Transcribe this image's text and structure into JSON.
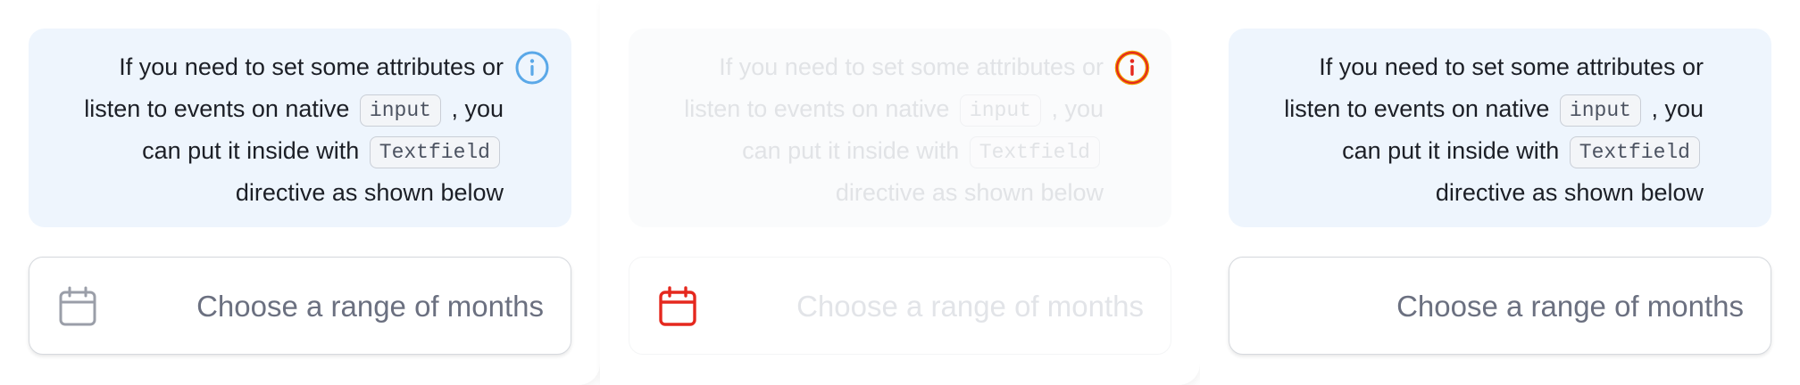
{
  "notice": {
    "line1": "If you need to set some attributes or",
    "line2_pre": "listen to events on native",
    "code_input": "input",
    "line2_post": ", you",
    "line3_pre": "can put it inside with",
    "code_textfield": "Textfield",
    "line4": "directive as shown below"
  },
  "field": {
    "placeholder": "Choose a range of months",
    "icon": "calendar-icon"
  },
  "icons": {
    "info": "info-icon",
    "calendar": "calendar-icon"
  },
  "colors": {
    "notice_bg": "#eef5fd",
    "info_blue": "#5aa8e8",
    "error_red": "#e5281e",
    "warning_orange": "#f0a000",
    "placeholder_gray": "#6b7080"
  },
  "panels": [
    {
      "state": "default"
    },
    {
      "state": "disabled-error"
    },
    {
      "state": "no-icon"
    }
  ]
}
